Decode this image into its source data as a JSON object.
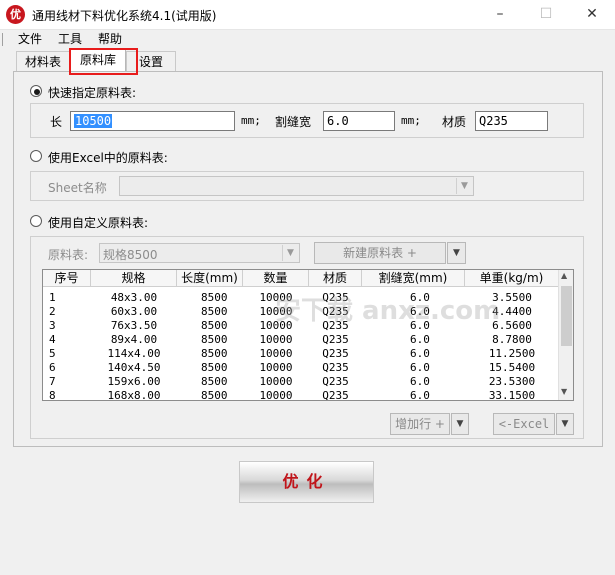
{
  "window": {
    "title": "通用线材下料优化系统4.1(试用版)",
    "icon_text": "优",
    "minimize": "–",
    "maximize": "☐",
    "close": "✕"
  },
  "menu": [
    "文件",
    "工具",
    "帮助"
  ],
  "tabs": [
    "材料表",
    "原料库",
    "设置"
  ],
  "quick": {
    "radio_label": "快速指定原料表:",
    "length_label": "长",
    "length_value": "10500",
    "mm1": "mm;",
    "kerf_label": "割缝宽",
    "kerf_value": "6.0",
    "mm2": "mm;",
    "material_label": "材质",
    "material_value": "Q235"
  },
  "excel": {
    "radio_label": "使用Excel中的原料表:",
    "sheet_label": "Sheet名称",
    "sheet_value": ""
  },
  "custom": {
    "radio_label": "使用自定义原料表:",
    "list_label": "原料表:",
    "list_value": "规格8500",
    "new_button": "新建原料表 +",
    "add_row_button": "增加行 +",
    "excel_button": "<-Excel"
  },
  "table": {
    "headers": [
      "序号",
      "规格",
      "长度(mm)",
      "数量",
      "材质",
      "割缝宽(mm)",
      "单重(kg/m)"
    ],
    "rows": [
      [
        "1",
        "48x3.00",
        "8500",
        "10000",
        "Q235",
        "6.0",
        "3.5500"
      ],
      [
        "2",
        "60x3.00",
        "8500",
        "10000",
        "Q235",
        "6.0",
        "4.4400"
      ],
      [
        "3",
        "76x3.50",
        "8500",
        "10000",
        "Q235",
        "6.0",
        "6.5600"
      ],
      [
        "4",
        "89x4.00",
        "8500",
        "10000",
        "Q235",
        "6.0",
        "8.7800"
      ],
      [
        "5",
        "114x4.00",
        "8500",
        "10000",
        "Q235",
        "6.0",
        "11.2500"
      ],
      [
        "6",
        "140x4.50",
        "8500",
        "10000",
        "Q235",
        "6.0",
        "15.5400"
      ],
      [
        "7",
        "159x6.00",
        "8500",
        "10000",
        "Q235",
        "6.0",
        "23.5300"
      ],
      [
        "8",
        "168x8.00",
        "8500",
        "10000",
        "Q235",
        "6.0",
        "33.1500"
      ]
    ]
  },
  "optimize_button": "优化",
  "watermark": "安下载 anxz.com"
}
